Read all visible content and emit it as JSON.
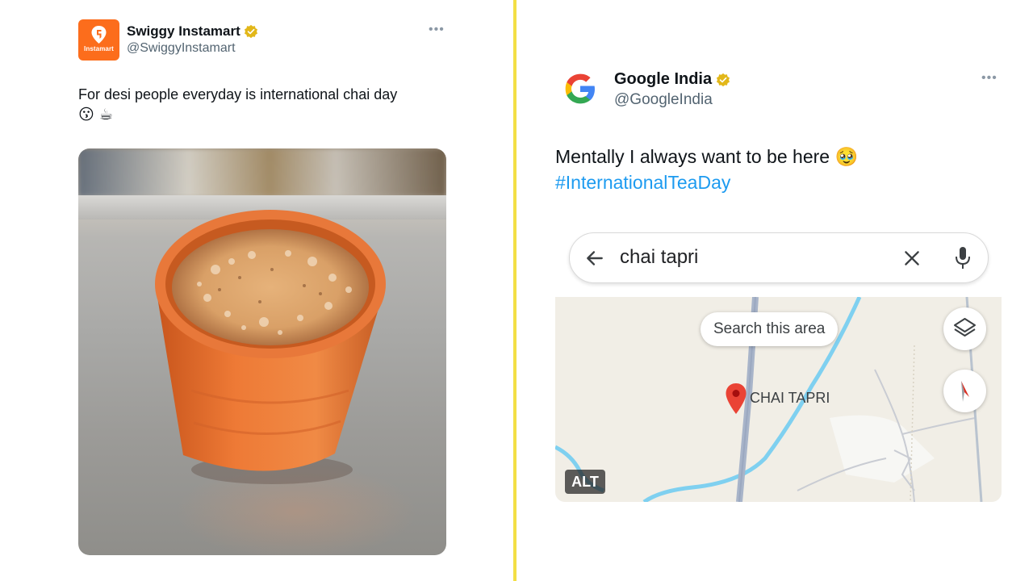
{
  "left_tweet": {
    "brand_badge": "Instamart",
    "name": "Swiggy Instamart",
    "handle": "@SwiggyInstamart",
    "more": "•••",
    "text": "For desi people everyday is international chai day",
    "emoji": [
      "😗",
      "☕"
    ],
    "colors": {
      "brand": "#fc6d1c",
      "verified": "#e2b719"
    }
  },
  "right_tweet": {
    "name": "Google India",
    "handle": "@GoogleIndia",
    "more": "•••",
    "text": "Mentally I always want to be here 🥹",
    "hashtag": "#InternationalTeaDay",
    "map": {
      "search_query": "chai tapri",
      "search_area_button": "Search this area",
      "pin_label": "CHAI TAPRI",
      "alt_badge": "ALT",
      "icons": [
        "back-arrow-icon",
        "clear-icon",
        "mic-icon",
        "layers-icon",
        "compass-icon",
        "location-pin-icon"
      ]
    },
    "colors": {
      "hashtag": "#1d9bf0",
      "verified": "#e2b719",
      "pin": "#ea4335"
    }
  },
  "divider_color": "#f3df45"
}
